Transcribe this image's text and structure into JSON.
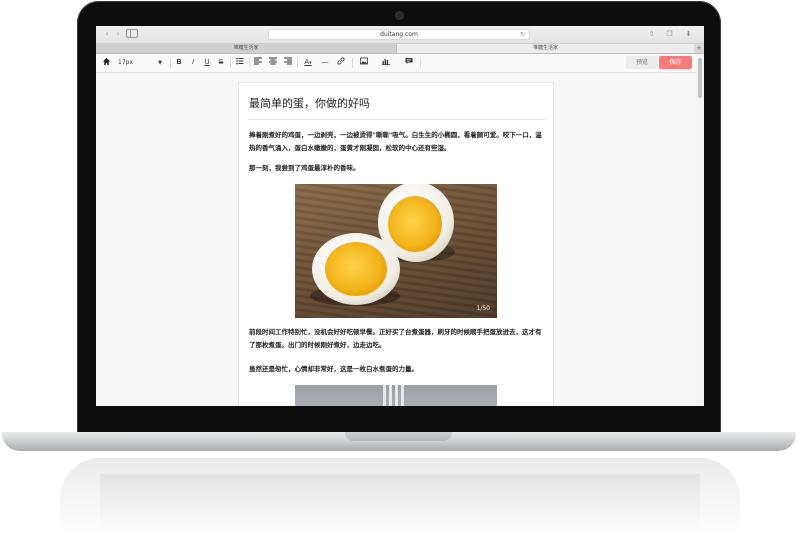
{
  "browser": {
    "address": "duitang.com",
    "tabs": [
      "堆糖生活家",
      "堆糖生活家"
    ]
  },
  "toolbar": {
    "font_size": "17px",
    "buttons": [
      "home-icon",
      "bold",
      "italic",
      "underline",
      "strikethrough",
      "unordered-list",
      "align-left",
      "align-center",
      "align-right",
      "font-color",
      "horizontal-rule",
      "link",
      "image",
      "chart",
      "comment"
    ],
    "bold_label": "B",
    "italic_label": "I",
    "underline_label": "U",
    "strike_label": "S",
    "font_color_label": "A",
    "preview_label": "预览",
    "save_label": "保存"
  },
  "colors": {
    "save_button": "#f77b7b",
    "preview_button": "#ececec"
  },
  "document": {
    "title": "最简单的蛋，你做的好吗",
    "paragraphs": [
      "捧着刚煮好的鸡蛋，一边剥壳，一边被烫得\"嘶嘶\"吸气。白生生的小椭圆，看着颇可爱。咬下一口，温热的香气涌入，蛋白水嫩嫩的，蛋黄才刚凝固，松软的中心还有些湿。",
      "那一刻，我尝到了鸡蛋最淳朴的香味。",
      "前段时间工作特别忙，没机会好好吃顿早餐。正好买了台煮蛋器，刷牙的时候顺手把蛋放进去，这才有了那枚煮蛋。出门的时候刚好煮好，边走边吃。",
      "虽然还是匆忙，心情却非常好，这是一枚白水煮蛋的力量。"
    ],
    "photo_counter": "1/50"
  }
}
